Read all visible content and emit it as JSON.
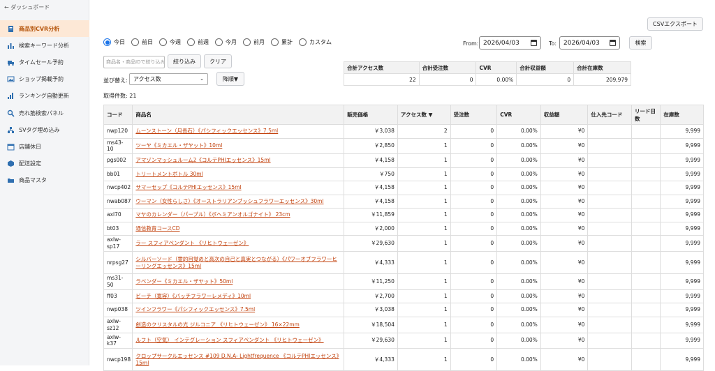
{
  "sidebar": {
    "back": "← ダッシュボード",
    "items": [
      {
        "label": "商品別CVR分析",
        "icon": "document-icon",
        "active": true
      },
      {
        "label": "検索キーワード分析",
        "icon": "bar-chart-icon"
      },
      {
        "label": "タイムセール予約",
        "icon": "car-icon"
      },
      {
        "label": "ショップ掲載予約",
        "icon": "image-icon"
      },
      {
        "label": "ランキング自動更新",
        "icon": "ranking-bars-icon"
      },
      {
        "label": "売れ筋検索パネル",
        "icon": "search-icon"
      },
      {
        "label": "SVタグ埋め込み",
        "icon": "sitemap-icon"
      },
      {
        "label": "店舗休日",
        "icon": "calendar-icon"
      },
      {
        "label": "配送設定",
        "icon": "box-icon"
      },
      {
        "label": "商品マスタ",
        "icon": "folder-icon"
      }
    ]
  },
  "toolbar": {
    "csv_export": "CSVエクスポート",
    "search": "検索",
    "filter": "絞り込み",
    "clear": "クリア",
    "order": "降順▼"
  },
  "period": {
    "options": [
      "今日",
      "前日",
      "今週",
      "前週",
      "今月",
      "前月",
      "累計",
      "カスタム"
    ],
    "selected": "今日"
  },
  "date_range": {
    "from_label": "From:",
    "from": "2026/04/03",
    "to_label": "To:",
    "to": "2026/04/03"
  },
  "filter": {
    "placeholder": "商品名・商品IDで絞り込み"
  },
  "sort": {
    "label": "並び替え:",
    "value": "アクセス数"
  },
  "count_label": "取得件数: 21",
  "summary": {
    "headers": [
      "合計アクセス数",
      "合計受注数",
      "CVR",
      "合計収益額",
      "合計在庫数"
    ],
    "values": [
      "22",
      "0",
      "0.00%",
      "0",
      "209,979"
    ]
  },
  "table": {
    "headers": [
      "コード",
      "商品名",
      "販売価格",
      "アクセス数 ▼",
      "受注数",
      "CVR",
      "収益額",
      "仕入先コード",
      "リード日数",
      "在庫数"
    ],
    "rows": [
      [
        "nwp120",
        "ムーンストーン（月長石）《パシフィックエッセンス》7.5ml",
        "￥3,038",
        "2",
        "0",
        "0.00%",
        "¥0",
        "",
        "",
        "9,999"
      ],
      [
        "ms43-10",
        "ツーヤ《ミカエル・ザヤット》10ml",
        "￥2,850",
        "1",
        "0",
        "0.00%",
        "¥0",
        "",
        "",
        "9,999"
      ],
      [
        "pgs002",
        "アマゾンマッシュルーム2《コルテPHIエッセンス》15ml",
        "￥4,158",
        "1",
        "0",
        "0.00%",
        "¥0",
        "",
        "",
        "9,999"
      ],
      [
        "bb01",
        "トリートメントボトル 30ml",
        "￥750",
        "1",
        "0",
        "0.00%",
        "¥0",
        "",
        "",
        "9,999"
      ],
      [
        "nwcp402",
        "サマーセップ《コルテPHIエッセンス》15ml",
        "￥4,158",
        "1",
        "0",
        "0.00%",
        "¥0",
        "",
        "",
        "9,999"
      ],
      [
        "nwab087",
        "ウーマン（女性らしさ）《オーストラリアンブッシュフラワーエッセンス》30ml",
        "￥4,158",
        "1",
        "0",
        "0.00%",
        "¥0",
        "",
        "",
        "9,999"
      ],
      [
        "axl70",
        "マヤのカレンダー（パープル）《ボヘミアンオルゴナイト》 23cm",
        "￥11,859",
        "1",
        "0",
        "0.00%",
        "¥0",
        "",
        "",
        "9,999"
      ],
      [
        "bt03",
        "通信教育コースCD",
        "￥2,000",
        "1",
        "0",
        "0.00%",
        "¥0",
        "",
        "",
        "9,999"
      ],
      [
        "axlw-sp17",
        "ラー スフィアペンダント 《リヒトウェーゼン》",
        "￥29,630",
        "1",
        "0",
        "0.00%",
        "¥0",
        "",
        "",
        "9,999"
      ],
      [
        "nrpsg27",
        "シルバーソード（霊的目覚めと高次の自己と真実とつながる）《パワーオブフラワーヒーリングエッセンス》15ml",
        "￥4,333",
        "1",
        "0",
        "0.00%",
        "¥0",
        "",
        "",
        "9,999"
      ],
      [
        "ms31-50",
        "ラベンダー《ミカエル・ザヤット》50ml",
        "￥11,250",
        "1",
        "0",
        "0.00%",
        "¥0",
        "",
        "",
        "9,999"
      ],
      [
        "ff03",
        "ビーチ（寛容）《バッチフラワーレメディ》10ml",
        "￥2,700",
        "1",
        "0",
        "0.00%",
        "¥0",
        "",
        "",
        "9,999"
      ],
      [
        "nwp038",
        "ツインフラワー《パシフィックエッセンス》7.5ml",
        "￥3,038",
        "1",
        "0",
        "0.00%",
        "¥0",
        "",
        "",
        "9,999"
      ],
      [
        "axlw-sz12",
        "創造のクリスタルの光 ジルコニア 《リヒトウェーゼン》 16×22mm",
        "￥18,504",
        "1",
        "0",
        "0.00%",
        "¥0",
        "",
        "",
        "9,999"
      ],
      [
        "axlw-k37",
        "ルフト（空気） インテグレーション スフィアペンダント 《リヒトウェーゼン》",
        "￥29,630",
        "1",
        "0",
        "0.00%",
        "¥0",
        "",
        "",
        "9,999"
      ],
      [
        "nwcp198",
        "クロップサークルエッセンス #109 D.N.A- Lightfrequence 《コルテPHIエッセンス》15ml",
        "￥4,333",
        "1",
        "0",
        "0.00%",
        "¥0",
        "",
        "",
        "9,999"
      ]
    ]
  }
}
